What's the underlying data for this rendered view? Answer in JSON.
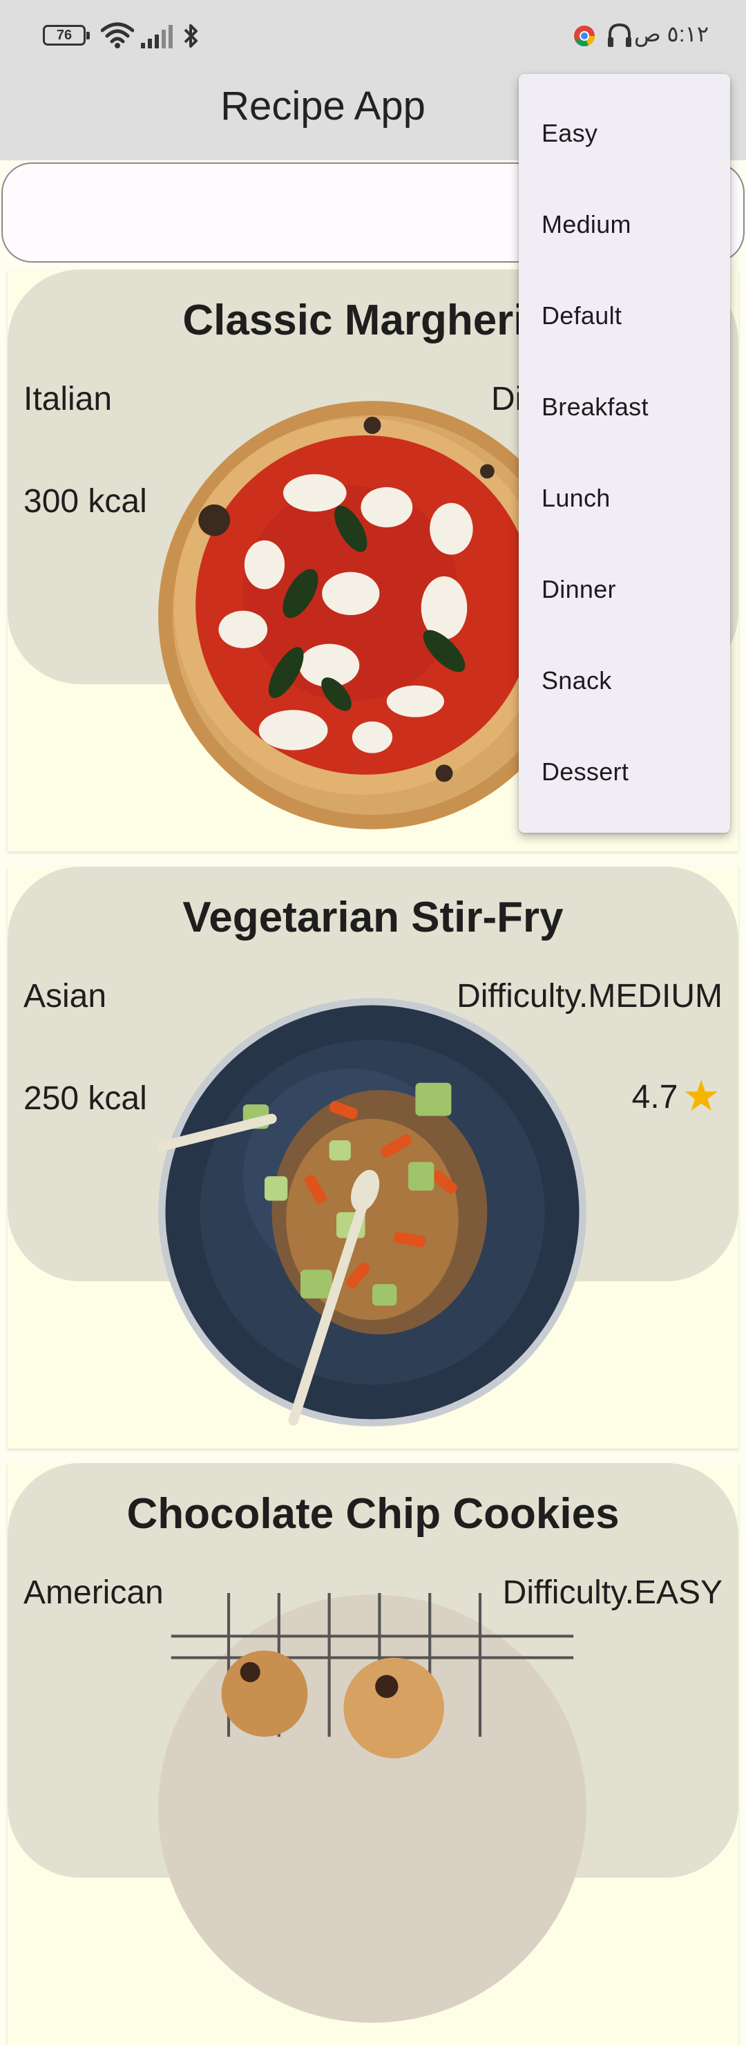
{
  "status_bar": {
    "battery": "76",
    "clock": "٥:١٢ ص",
    "icons": [
      "wifi-icon",
      "signal-icon",
      "bluetooth-icon",
      "chrome-icon",
      "headphones-icon"
    ]
  },
  "app_bar": {
    "title": "Recipe App"
  },
  "search": {
    "value": ""
  },
  "recipes": [
    {
      "title": "Classic Margherita",
      "cuisine": "Italian",
      "difficulty": "Di",
      "calories": "300 kcal",
      "rating": ""
    },
    {
      "title": "Vegetarian Stir-Fry",
      "cuisine": "Asian",
      "difficulty": "Difficulty.MEDIUM",
      "calories": "250 kcal",
      "rating": "4.7"
    },
    {
      "title": "Chocolate Chip Cookies",
      "cuisine": "American",
      "difficulty": "Difficulty.EASY",
      "calories": "",
      "rating": ""
    }
  ],
  "menu": {
    "items": [
      "Easy",
      "Medium",
      "Default",
      "Breakfast",
      "Lunch",
      "Dinner",
      "Snack",
      "Dessert"
    ]
  },
  "colors": {
    "card_background": "#fefde6",
    "card_panel": "#e2e0d0",
    "menu_background": "#f1edf4",
    "star": "#f6b400",
    "bar_background": "#dedede"
  }
}
